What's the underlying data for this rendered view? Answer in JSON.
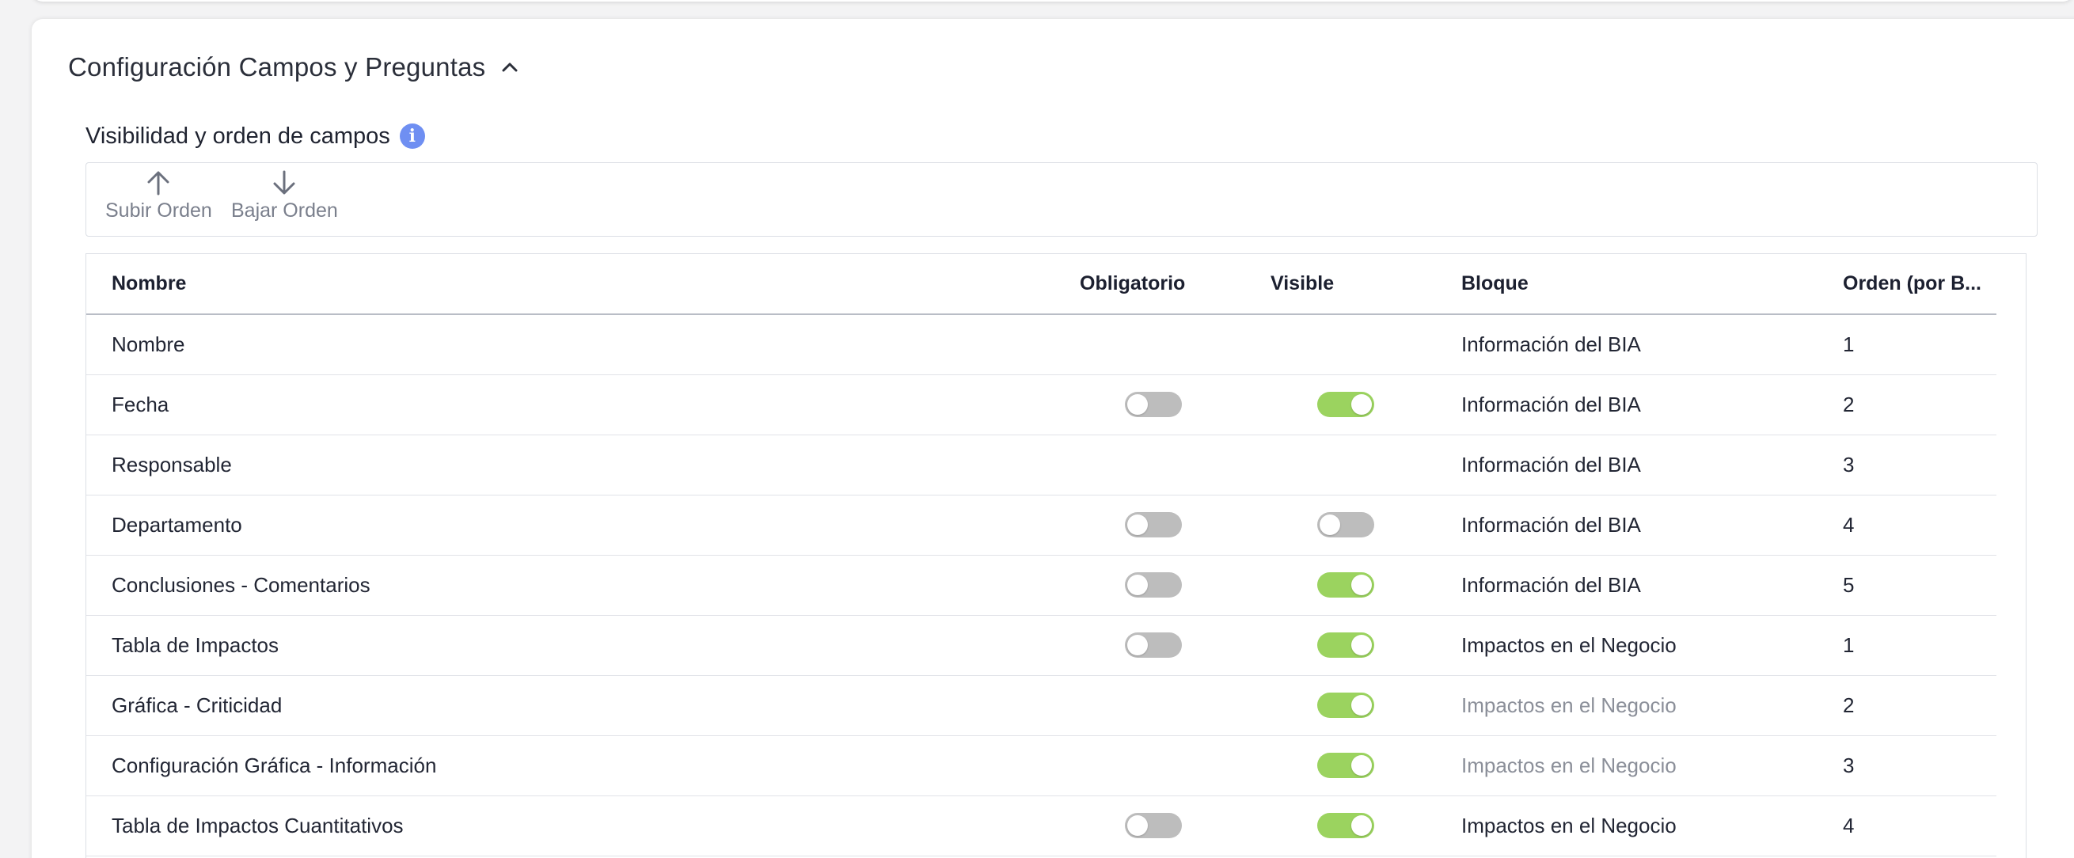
{
  "section": {
    "title": "Configuración Campos y Preguntas"
  },
  "subsection": {
    "title": "Visibilidad y orden de campos",
    "info_icon": "info-icon"
  },
  "toolbar": {
    "up_label": "Subir Orden",
    "down_label": "Bajar Orden"
  },
  "colors": {
    "toggle_on": "#9bd35f",
    "toggle_off": "#bdbdbd",
    "info": "#6f8ff2"
  },
  "table": {
    "headers": {
      "nombre": "Nombre",
      "obligatorio": "Obligatorio",
      "visible": "Visible",
      "bloque": "Bloque",
      "orden": "Orden (por B..."
    },
    "rows": [
      {
        "nombre": "Nombre",
        "obligatorio": null,
        "visible": null,
        "bloque": "Información del BIA",
        "bloque_muted": false,
        "orden": "1"
      },
      {
        "nombre": "Fecha",
        "obligatorio": false,
        "visible": true,
        "bloque": "Información del BIA",
        "bloque_muted": false,
        "orden": "2"
      },
      {
        "nombre": "Responsable",
        "obligatorio": null,
        "visible": null,
        "bloque": "Información del BIA",
        "bloque_muted": false,
        "orden": "3"
      },
      {
        "nombre": "Departamento",
        "obligatorio": false,
        "visible": false,
        "bloque": "Información del BIA",
        "bloque_muted": false,
        "orden": "4"
      },
      {
        "nombre": "Conclusiones - Comentarios",
        "obligatorio": false,
        "visible": true,
        "bloque": "Información del BIA",
        "bloque_muted": false,
        "orden": "5"
      },
      {
        "nombre": "Tabla de Impactos",
        "obligatorio": false,
        "visible": true,
        "bloque": "Impactos en el Negocio",
        "bloque_muted": false,
        "orden": "1"
      },
      {
        "nombre": "Gráfica - Criticidad",
        "obligatorio": null,
        "visible": true,
        "bloque": "Impactos en el Negocio",
        "bloque_muted": true,
        "orden": "2"
      },
      {
        "nombre": "Configuración Gráfica - Información",
        "obligatorio": null,
        "visible": true,
        "bloque": "Impactos en el Negocio",
        "bloque_muted": true,
        "orden": "3"
      },
      {
        "nombre": "Tabla de Impactos Cuantitativos",
        "obligatorio": false,
        "visible": true,
        "bloque": "Impactos en el Negocio",
        "bloque_muted": false,
        "orden": "4"
      }
    ]
  }
}
